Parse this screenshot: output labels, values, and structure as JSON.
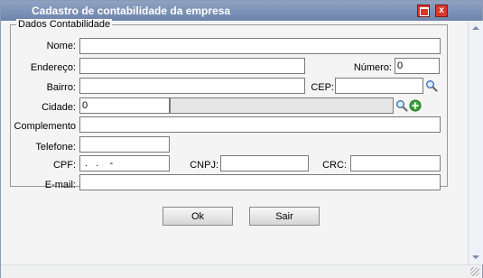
{
  "window": {
    "title": "Cadastro de contabilidade da empresa",
    "maximize_icon": "maximize-icon",
    "close_icon": "close-icon",
    "close_glyph": "x"
  },
  "fieldset": {
    "legend": "Dados Contabilidade"
  },
  "fields": {
    "nome": {
      "label": "Nome:",
      "value": ""
    },
    "endereco": {
      "label": "Endereço:",
      "value": ""
    },
    "numero": {
      "label": "Número:",
      "value": "0"
    },
    "bairro": {
      "label": "Bairro:",
      "value": ""
    },
    "cep": {
      "label": "CEP:",
      "value": "",
      "icon": "search-icon"
    },
    "cidade": {
      "label": "Cidade:",
      "code": "0",
      "name": "",
      "search_icon": "search-icon",
      "add_icon": "add-icon"
    },
    "complemento": {
      "label": "Complemento",
      "value": ""
    },
    "telefone": {
      "label": "Telefone:",
      "value": ""
    },
    "cpf": {
      "label": "CPF:",
      "value": " .   .    -"
    },
    "cnpj": {
      "label": "CNPJ:",
      "value": ""
    },
    "crc": {
      "label": "CRC:",
      "value": ""
    },
    "email": {
      "label": "E-mail:",
      "value": ""
    }
  },
  "buttons": {
    "ok": "Ok",
    "sair": "Sair"
  },
  "colors": {
    "titlebar": "#7b90b5",
    "close": "#d9362e",
    "add": "#3aa43a"
  }
}
